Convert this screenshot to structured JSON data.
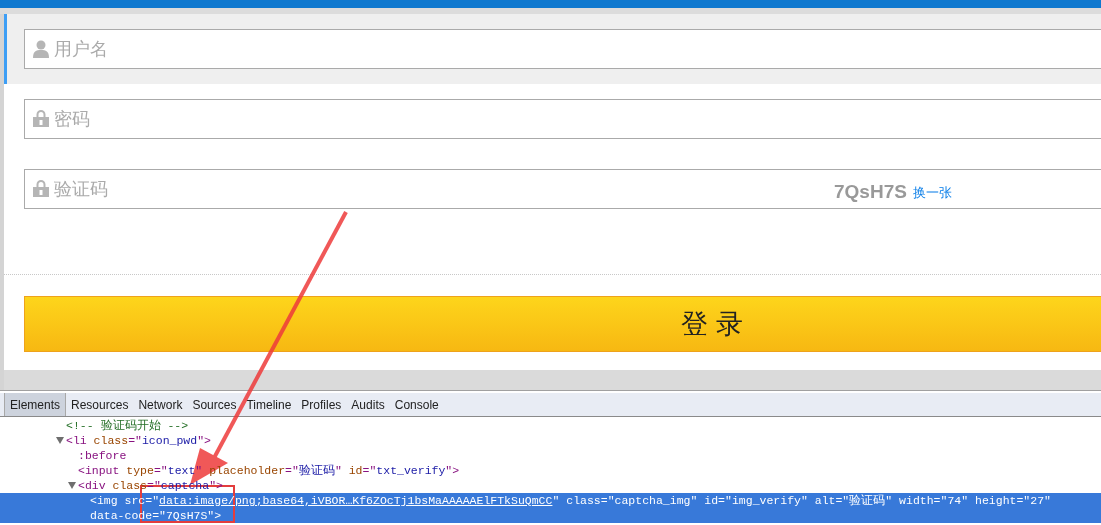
{
  "login_form": {
    "username": {
      "placeholder": "用户名",
      "focused": true
    },
    "password": {
      "placeholder": "密码"
    },
    "captcha": {
      "placeholder": "验证码",
      "code": "7QsH7S",
      "refresh_link": "换一张"
    },
    "login_button": "登 录"
  },
  "devtools": {
    "tabs": [
      {
        "label": "Elements",
        "selected": true
      },
      {
        "label": "Resources",
        "selected": false
      },
      {
        "label": "Network",
        "selected": false
      },
      {
        "label": "Sources",
        "selected": false
      },
      {
        "label": "Timeline",
        "selected": false
      },
      {
        "label": "Profiles",
        "selected": false
      },
      {
        "label": "Audits",
        "selected": false
      },
      {
        "label": "Console",
        "selected": false
      }
    ],
    "nodes": [
      {
        "selected": false,
        "tokens": [
          {
            "kind": "comment",
            "text": "<!-- 验证码开始 -->"
          }
        ]
      },
      {
        "selected": false,
        "expanded": true,
        "tokens": [
          {
            "kind": "tag",
            "text": "<li "
          },
          {
            "kind": "attr",
            "text": "class"
          },
          {
            "kind": "tag",
            "text": "=\""
          },
          {
            "kind": "value",
            "text": "icon_pwd"
          },
          {
            "kind": "tag",
            "text": "\">"
          }
        ],
        "children": [
          {
            "selected": false,
            "tokens": [
              {
                "kind": "pseudo",
                "text": ":before"
              }
            ]
          },
          {
            "selected": false,
            "tokens": [
              {
                "kind": "tag",
                "text": "<input "
              },
              {
                "kind": "attr",
                "text": "type"
              },
              {
                "kind": "tag",
                "text": "=\""
              },
              {
                "kind": "value",
                "text": "text"
              },
              {
                "kind": "tag",
                "text": "\" "
              },
              {
                "kind": "attr",
                "text": "placeholder"
              },
              {
                "kind": "tag",
                "text": "=\""
              },
              {
                "kind": "value",
                "text": "验证码"
              },
              {
                "kind": "tag",
                "text": "\" "
              },
              {
                "kind": "attr",
                "text": "id"
              },
              {
                "kind": "tag",
                "text": "=\""
              },
              {
                "kind": "value",
                "text": "txt_verify"
              },
              {
                "kind": "tag",
                "text": "\">"
              }
            ]
          },
          {
            "selected": false,
            "expanded": true,
            "tokens": [
              {
                "kind": "tag",
                "text": "<div "
              },
              {
                "kind": "attr",
                "text": "class"
              },
              {
                "kind": "tag",
                "text": "=\""
              },
              {
                "kind": "value",
                "text": "captcha"
              },
              {
                "kind": "tag",
                "text": "\">"
              }
            ],
            "children": [
              {
                "selected": true,
                "tokens": [
                  {
                    "kind": "tag",
                    "text": "<img "
                  },
                  {
                    "kind": "attr",
                    "text": "src"
                  },
                  {
                    "kind": "tag",
                    "text": "=\""
                  },
                  {
                    "kind": "link",
                    "text": "data:image/png;base64,iVBOR…Kf6ZOcTj1bsMaAAAAAElFTkSuQmCC"
                  },
                  {
                    "kind": "tag",
                    "text": "\" "
                  },
                  {
                    "kind": "attr",
                    "text": "class"
                  },
                  {
                    "kind": "tag",
                    "text": "=\""
                  },
                  {
                    "kind": "value",
                    "text": "captcha_img"
                  },
                  {
                    "kind": "tag",
                    "text": "\" "
                  },
                  {
                    "kind": "attr",
                    "text": "id"
                  },
                  {
                    "kind": "tag",
                    "text": "=\""
                  },
                  {
                    "kind": "value",
                    "text": "img_verify"
                  },
                  {
                    "kind": "tag",
                    "text": "\" "
                  },
                  {
                    "kind": "attr",
                    "text": "alt"
                  },
                  {
                    "kind": "tag",
                    "text": "=\""
                  },
                  {
                    "kind": "value",
                    "text": "验证码"
                  },
                  {
                    "kind": "tag",
                    "text": "\" "
                  },
                  {
                    "kind": "attr",
                    "text": "width"
                  },
                  {
                    "kind": "tag",
                    "text": "=\""
                  },
                  {
                    "kind": "value",
                    "text": "74"
                  },
                  {
                    "kind": "tag",
                    "text": "\" "
                  },
                  {
                    "kind": "attr",
                    "text": "height"
                  },
                  {
                    "kind": "tag",
                    "text": "=\""
                  },
                  {
                    "kind": "value",
                    "text": "27"
                  },
                  {
                    "kind": "tag",
                    "text": "\" "
                  },
                  {
                    "kind": "attr",
                    "text": "data-code"
                  },
                  {
                    "kind": "tag",
                    "text": "=\""
                  },
                  {
                    "kind": "value",
                    "text": "7QsH7S"
                  },
                  {
                    "kind": "tag",
                    "text": "\">"
                  }
                ]
              }
            ]
          }
        ]
      }
    ]
  }
}
